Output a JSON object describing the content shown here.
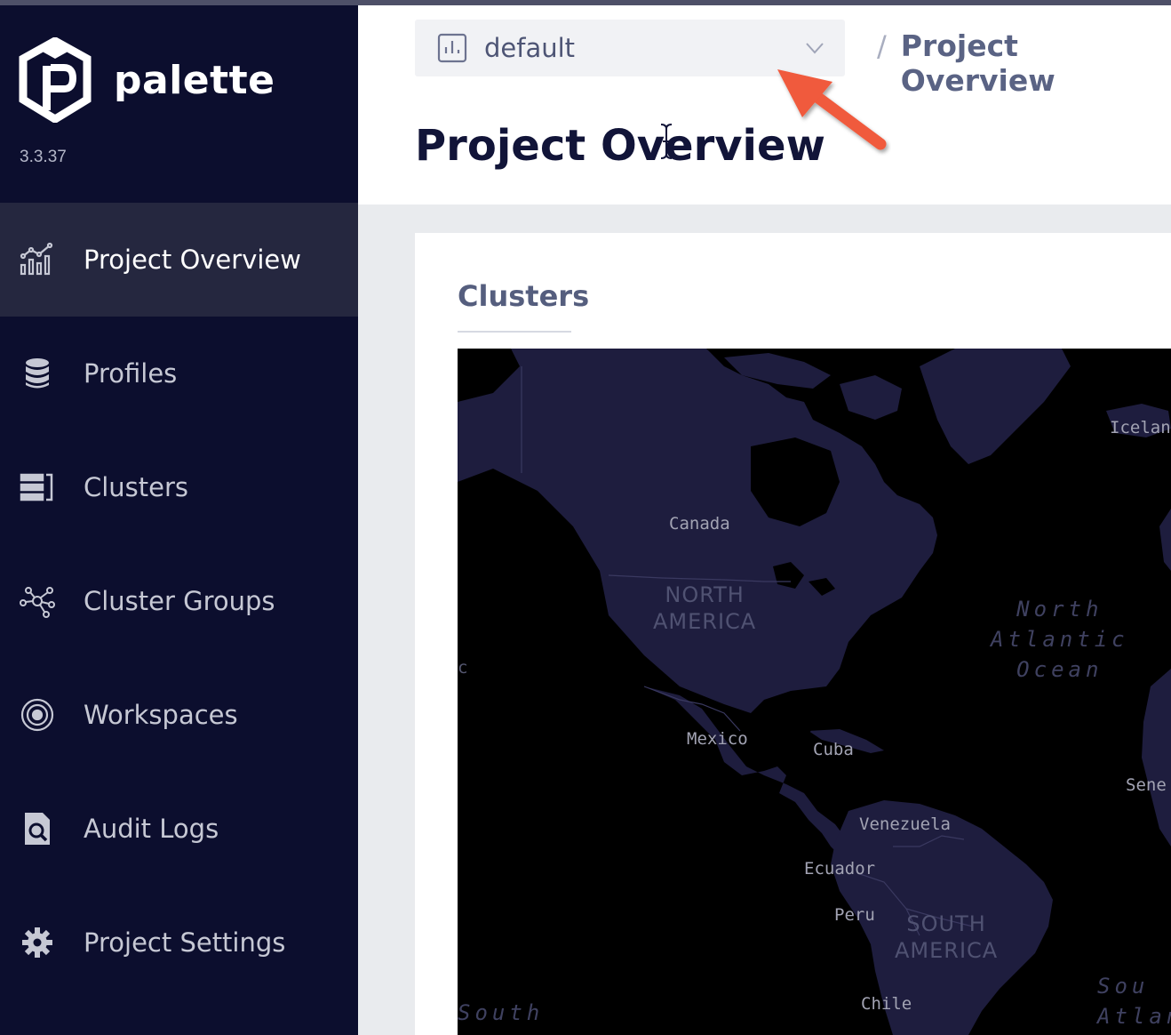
{
  "app": {
    "name": "palette",
    "version": "3.3.37"
  },
  "sidebar": {
    "items": [
      {
        "label": "Project Overview",
        "icon": "chart-icon",
        "active": true
      },
      {
        "label": "Profiles",
        "icon": "database-icon",
        "active": false
      },
      {
        "label": "Clusters",
        "icon": "server-list-icon",
        "active": false
      },
      {
        "label": "Cluster Groups",
        "icon": "network-icon",
        "active": false
      },
      {
        "label": "Workspaces",
        "icon": "orbit-icon",
        "active": false
      },
      {
        "label": "Audit Logs",
        "icon": "file-search-icon",
        "active": false
      },
      {
        "label": "Project Settings",
        "icon": "gear-icon",
        "active": false
      }
    ]
  },
  "header": {
    "project_select": {
      "value": "default",
      "icon": "project-chart-icon",
      "chevron": "chevron-down-icon"
    },
    "breadcrumb": {
      "separator": "/",
      "current": "Project Overview"
    },
    "page_title": "Project Overview"
  },
  "main": {
    "section_title": "Clusters",
    "map": {
      "labels": {
        "canada": "Canada",
        "north_america": "NORTH\nAMERICA",
        "north_atlantic": "North\nAtlantic\nOcean",
        "iceland": "Iceland",
        "mexico": "Mexico",
        "cuba": "Cuba",
        "venezuela": "Venezuela",
        "ecuador": "Ecuador",
        "peru": "Peru",
        "south_america": "SOUTH\nAMERICA",
        "chile": "Chile",
        "senegal": "Sene",
        "south_cut": "South",
        "south_atl_cut": "Sou\nAtlan",
        "left_c": "c"
      }
    }
  },
  "colors": {
    "sidebar_bg": "#0c0e2e",
    "sidebar_active": "#25273f",
    "land": "#1e1d3e",
    "water": "#000000",
    "annotation": "#f05a3c"
  }
}
